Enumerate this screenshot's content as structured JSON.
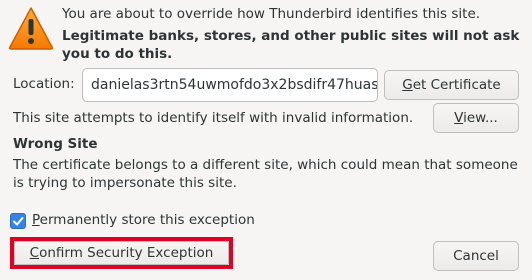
{
  "intro_text": "You are about to override how Thunderbird identifies this site.",
  "warning_bold": "Legitimate banks, stores, and other public sites will not ask you to do this.",
  "location": {
    "label": "Location:",
    "value": "danielas3rtn54uwmofdo3x2bsdifr47huas"
  },
  "buttons": {
    "get_certificate_first": "G",
    "get_certificate_rest": "et Certificate",
    "view_first": "V",
    "view_rest": "iew...",
    "confirm_first": "C",
    "confirm_rest": "onfirm Security Exception",
    "cancel": "Cancel"
  },
  "invalid_info": "This site attempts to identify itself with invalid information.",
  "wrong_site": {
    "title": "Wrong Site",
    "description": "The certificate belongs to a different site, which could mean that someone is trying to impersonate this site."
  },
  "checkbox": {
    "label_first": "P",
    "label_rest": "ermanently store this exception",
    "checked": true
  },
  "colors": {
    "accent": "#3584e4",
    "highlight_border": "#e00023",
    "warning_orange": "#f57900"
  },
  "icons": {
    "warning": "warning-triangle-icon",
    "checkmark": "checkmark-icon"
  }
}
